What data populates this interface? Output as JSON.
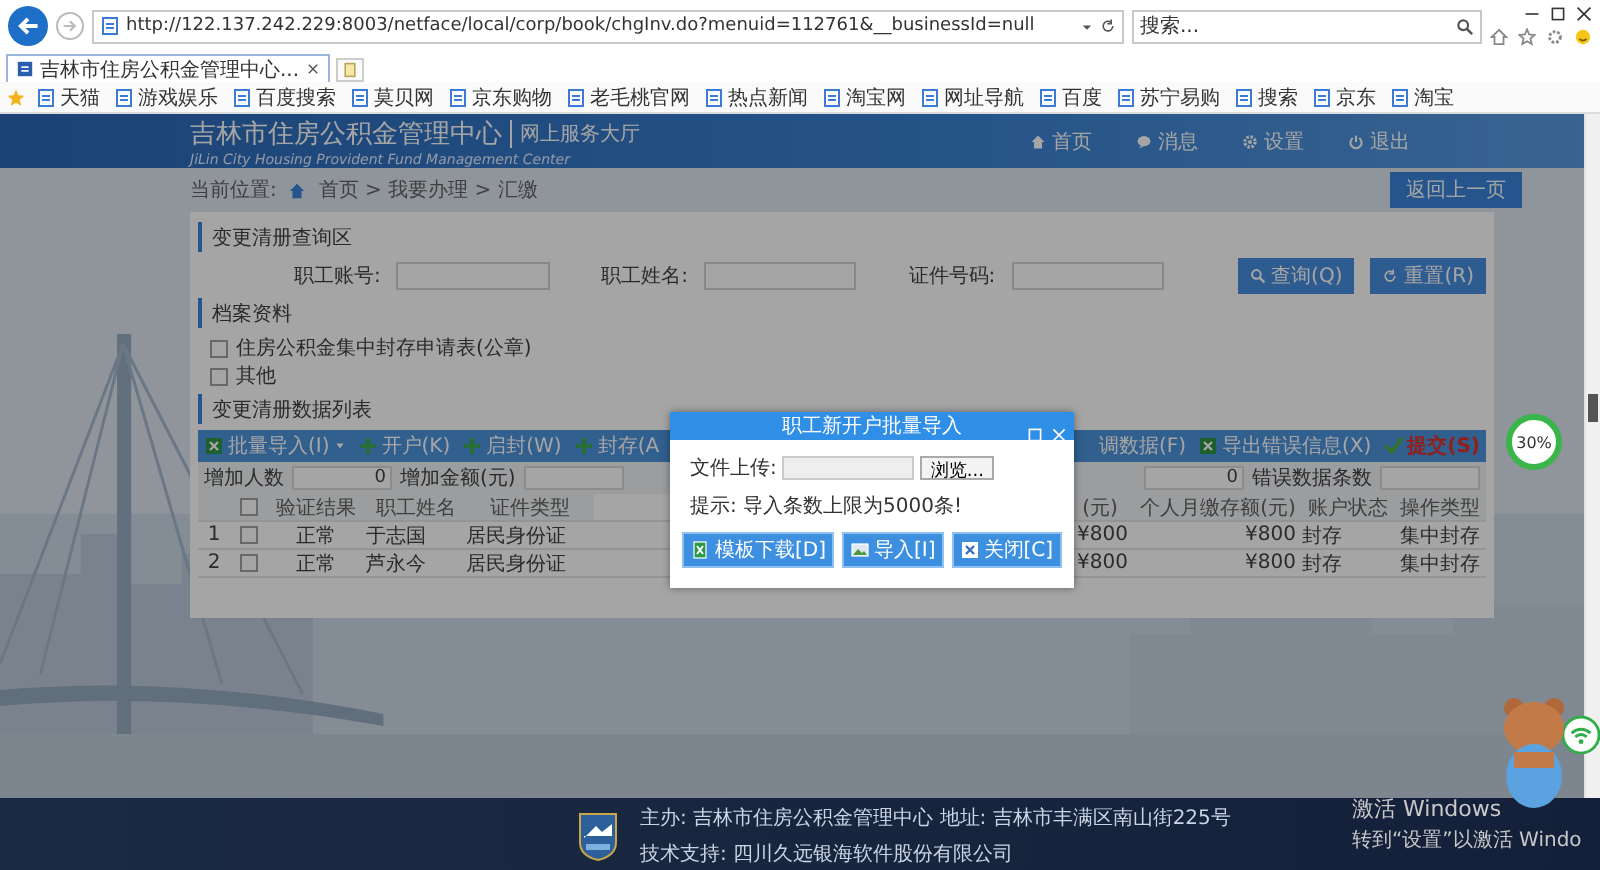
{
  "browser": {
    "address": "http://122.137.242.229:8003/netface/local/corp/book/chgInv.do?menuid=112761&__businessId=null",
    "search": {
      "placeholder": "搜索..."
    },
    "tabs": [
      {
        "label": "吉林市住房公积金管理中心...",
        "selected": true
      }
    ],
    "favorites": [
      "天猫",
      "游戏娱乐",
      "百度搜索",
      "莫贝网",
      "京东购物",
      "老毛桃官网",
      "热点新闻",
      "淘宝网",
      "网址导航",
      "百度",
      "苏宁易购",
      "搜索",
      "京东",
      "淘宝"
    ]
  },
  "header": {
    "title": "吉林市住房公积金管理中心",
    "subtitle": "网上服务大厅",
    "english": "JiLin City Housing Provident Fund Management Center",
    "nav": [
      {
        "label": "首页",
        "kind": "home"
      },
      {
        "label": "消息",
        "kind": "message"
      },
      {
        "label": "设置",
        "kind": "settings"
      },
      {
        "label": "退出",
        "kind": "logout"
      }
    ]
  },
  "breadcrumb": {
    "label": "当前位置:",
    "path": "首页 > 我要办理 > 汇缴",
    "back_button": "返回上一页"
  },
  "query": {
    "title": "变更清册查询区",
    "fields": [
      "职工账号:",
      "职工姓名:",
      "证件号码:"
    ],
    "buttons": [
      {
        "label": "查询(Q)",
        "kind": "search"
      },
      {
        "label": "重置(R)",
        "kind": "reset"
      }
    ]
  },
  "archive": {
    "title": "档案资料",
    "items": [
      {
        "label": "住房公积金集中封存申请表(公章)",
        "checked": false
      },
      {
        "label": "其他",
        "checked": false
      }
    ]
  },
  "list": {
    "title": "变更清册数据列表",
    "toolbar_left": [
      {
        "label": "批量导入(I)",
        "kind": "import"
      },
      {
        "label": "开户(K)",
        "kind": "add"
      },
      {
        "label": "启封(W)",
        "kind": "add"
      },
      {
        "label": "封存(A",
        "kind": "add"
      }
    ],
    "toolbar_right": [
      {
        "label": "调数据(F)",
        "kind": "text"
      },
      {
        "label": "导出错误信息(X)",
        "kind": "excel"
      },
      {
        "label": "提交(S)",
        "kind": "submit"
      }
    ],
    "stats_left": [
      {
        "label": "增加人数",
        "value": "0"
      },
      {
        "label": "增加金额(元)"
      }
    ],
    "stats_right": [
      {
        "value": "0"
      },
      {
        "label": "错误数据条数"
      }
    ],
    "table": {
      "header_checked": false,
      "columns_left": [
        "验证结果",
        "职工姓名",
        "证件类型"
      ],
      "columns_right": [
        "(元)",
        "个人月缴存额(元)",
        "账户状态",
        "操作类型"
      ],
      "rows": [
        {
          "index": "1",
          "checked": false,
          "cells_left": [
            "正常",
            "于志国",
            "居民身份证"
          ],
          "cells_right": [
            "¥800",
            "¥800",
            "封存",
            "集中封存"
          ]
        },
        {
          "index": "2",
          "checked": false,
          "cells_left": [
            "正常",
            "芦永今",
            "居民身份证"
          ],
          "cells_right": [
            "¥800",
            "¥800",
            "封存",
            "集中封存"
          ]
        }
      ]
    }
  },
  "dialog": {
    "title": "职工新开户批量导入",
    "file_label": "文件上传:",
    "browse_button": "浏览...",
    "hint": "提示: 导入条数上限为5000条!",
    "buttons": [
      {
        "label": "模板下载[D]",
        "kind": "download"
      },
      {
        "label": "导入[I]",
        "kind": "import"
      },
      {
        "label": "关闭[C]",
        "kind": "close"
      }
    ]
  },
  "speed_widget": {
    "percent": "30%"
  },
  "footer": {
    "host_label": "主办:",
    "host": "吉林市住房公积金管理中心",
    "address_label": "地址:",
    "address": "吉林市丰满区南山街225号",
    "support_label": "技术支持:",
    "support": "四川久远银海软件股份有限公司"
  },
  "activation": {
    "title": "激活 Windows",
    "text": "转到“设置”以激活 Windo"
  }
}
